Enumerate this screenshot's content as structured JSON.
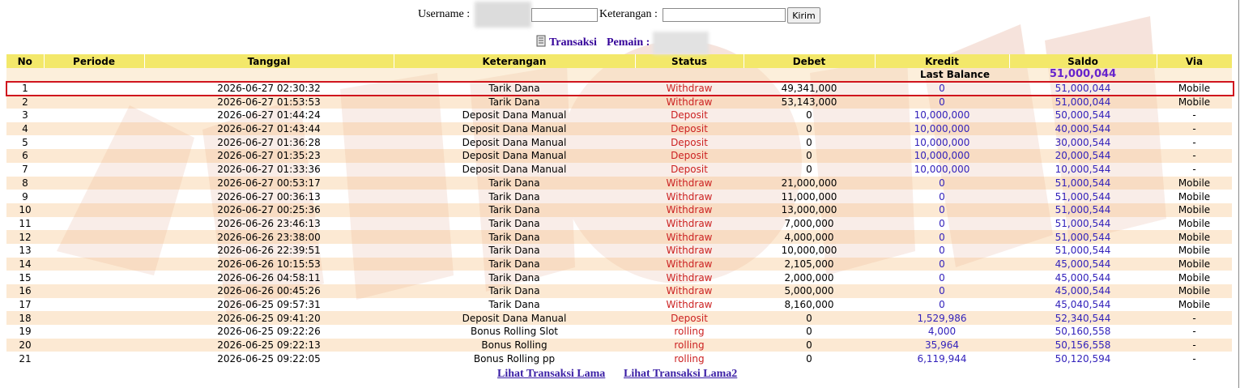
{
  "form": {
    "username_label": "Username :",
    "username_value": "",
    "keterangan_label": "Keterangan :",
    "keterangan_value": "",
    "submit_label": "Kirim"
  },
  "subheader": {
    "transaksi_label": "Transaksi",
    "pemain_label": "Pemain :"
  },
  "table": {
    "columns": [
      "No",
      "Periode",
      "Tanggal",
      "Keterangan",
      "Status",
      "Debet",
      "Kredit",
      "Saldo",
      "Via"
    ],
    "last_balance_label": "Last Balance",
    "last_balance_value": "51,000,044",
    "rows": [
      {
        "no": "1",
        "periode": "",
        "tanggal": "2026-06-27 02:30:32",
        "keterangan": "Tarik Dana",
        "status": "Withdraw",
        "debet": "49,341,000",
        "kredit": "0",
        "saldo": "51,000,044",
        "via": "Mobile"
      },
      {
        "no": "2",
        "periode": "",
        "tanggal": "2026-06-27 01:53:53",
        "keterangan": "Tarik Dana",
        "status": "Withdraw",
        "debet": "53,143,000",
        "kredit": "0",
        "saldo": "51,000,044",
        "via": "Mobile"
      },
      {
        "no": "3",
        "periode": "",
        "tanggal": "2026-06-27 01:44:24",
        "keterangan": "Deposit Dana Manual",
        "status": "Deposit",
        "debet": "0",
        "kredit": "10,000,000",
        "saldo": "50,000,544",
        "via": "-"
      },
      {
        "no": "4",
        "periode": "",
        "tanggal": "2026-06-27 01:43:44",
        "keterangan": "Deposit Dana Manual",
        "status": "Deposit",
        "debet": "0",
        "kredit": "10,000,000",
        "saldo": "40,000,544",
        "via": "-"
      },
      {
        "no": "5",
        "periode": "",
        "tanggal": "2026-06-27 01:36:28",
        "keterangan": "Deposit Dana Manual",
        "status": "Deposit",
        "debet": "0",
        "kredit": "10,000,000",
        "saldo": "30,000,544",
        "via": "-"
      },
      {
        "no": "6",
        "periode": "",
        "tanggal": "2026-06-27 01:35:23",
        "keterangan": "Deposit Dana Manual",
        "status": "Deposit",
        "debet": "0",
        "kredit": "10,000,000",
        "saldo": "20,000,544",
        "via": "-"
      },
      {
        "no": "7",
        "periode": "",
        "tanggal": "2026-06-27 01:33:36",
        "keterangan": "Deposit Dana Manual",
        "status": "Deposit",
        "debet": "0",
        "kredit": "10,000,000",
        "saldo": "10,000,544",
        "via": "-"
      },
      {
        "no": "8",
        "periode": "",
        "tanggal": "2026-06-27 00:53:17",
        "keterangan": "Tarik Dana",
        "status": "Withdraw",
        "debet": "21,000,000",
        "kredit": "0",
        "saldo": "51,000,544",
        "via": "Mobile"
      },
      {
        "no": "9",
        "periode": "",
        "tanggal": "2026-06-27 00:36:13",
        "keterangan": "Tarik Dana",
        "status": "Withdraw",
        "debet": "11,000,000",
        "kredit": "0",
        "saldo": "51,000,544",
        "via": "Mobile"
      },
      {
        "no": "10",
        "periode": "",
        "tanggal": "2026-06-27 00:25:36",
        "keterangan": "Tarik Dana",
        "status": "Withdraw",
        "debet": "13,000,000",
        "kredit": "0",
        "saldo": "51,000,544",
        "via": "Mobile"
      },
      {
        "no": "11",
        "periode": "",
        "tanggal": "2026-06-26 23:46:13",
        "keterangan": "Tarik Dana",
        "status": "Withdraw",
        "debet": "7,000,000",
        "kredit": "0",
        "saldo": "51,000,544",
        "via": "Mobile"
      },
      {
        "no": "12",
        "periode": "",
        "tanggal": "2026-06-26 23:38:00",
        "keterangan": "Tarik Dana",
        "status": "Withdraw",
        "debet": "4,000,000",
        "kredit": "0",
        "saldo": "51,000,544",
        "via": "Mobile"
      },
      {
        "no": "13",
        "periode": "",
        "tanggal": "2026-06-26 22:39:51",
        "keterangan": "Tarik Dana",
        "status": "Withdraw",
        "debet": "10,000,000",
        "kredit": "0",
        "saldo": "51,000,544",
        "via": "Mobile"
      },
      {
        "no": "14",
        "periode": "",
        "tanggal": "2026-06-26 10:15:53",
        "keterangan": "Tarik Dana",
        "status": "Withdraw",
        "debet": "2,105,000",
        "kredit": "0",
        "saldo": "45,000,544",
        "via": "Mobile"
      },
      {
        "no": "15",
        "periode": "",
        "tanggal": "2026-06-26 04:58:11",
        "keterangan": "Tarik Dana",
        "status": "Withdraw",
        "debet": "2,000,000",
        "kredit": "0",
        "saldo": "45,000,544",
        "via": "Mobile"
      },
      {
        "no": "16",
        "periode": "",
        "tanggal": "2026-06-26 00:45:26",
        "keterangan": "Tarik Dana",
        "status": "Withdraw",
        "debet": "5,000,000",
        "kredit": "0",
        "saldo": "45,000,544",
        "via": "Mobile"
      },
      {
        "no": "17",
        "periode": "",
        "tanggal": "2026-06-25 09:57:31",
        "keterangan": "Tarik Dana",
        "status": "Withdraw",
        "debet": "8,160,000",
        "kredit": "0",
        "saldo": "45,040,544",
        "via": "Mobile"
      },
      {
        "no": "18",
        "periode": "",
        "tanggal": "2026-06-25 09:41:20",
        "keterangan": "Deposit Dana Manual",
        "status": "Deposit",
        "debet": "0",
        "kredit": "1,529,986",
        "saldo": "52,340,544",
        "via": "-"
      },
      {
        "no": "19",
        "periode": "",
        "tanggal": "2026-06-25 09:22:26",
        "keterangan": "Bonus Rolling Slot",
        "status": "rolling",
        "debet": "0",
        "kredit": "4,000",
        "saldo": "50,160,558",
        "via": "-"
      },
      {
        "no": "20",
        "periode": "",
        "tanggal": "2026-06-25 09:22:13",
        "keterangan": "Bonus Rolling",
        "status": "rolling",
        "debet": "0",
        "kredit": "35,964",
        "saldo": "50,156,558",
        "via": "-"
      },
      {
        "no": "21",
        "periode": "",
        "tanggal": "2026-06-25 09:22:05",
        "keterangan": "Bonus Rolling pp",
        "status": "rolling",
        "debet": "0",
        "kredit": "6,119,944",
        "saldo": "50,120,594",
        "via": "-"
      }
    ]
  },
  "footer": {
    "link1": "Lihat Transaksi Lama",
    "link2": "Lihat Transaksi Lama2"
  },
  "colors": {
    "header_bg": "#f3e86a",
    "status_text": "#cc2222",
    "amount_text": "#3322bb",
    "link_text": "#3a1ea5",
    "highlight_border": "#d0151e"
  }
}
